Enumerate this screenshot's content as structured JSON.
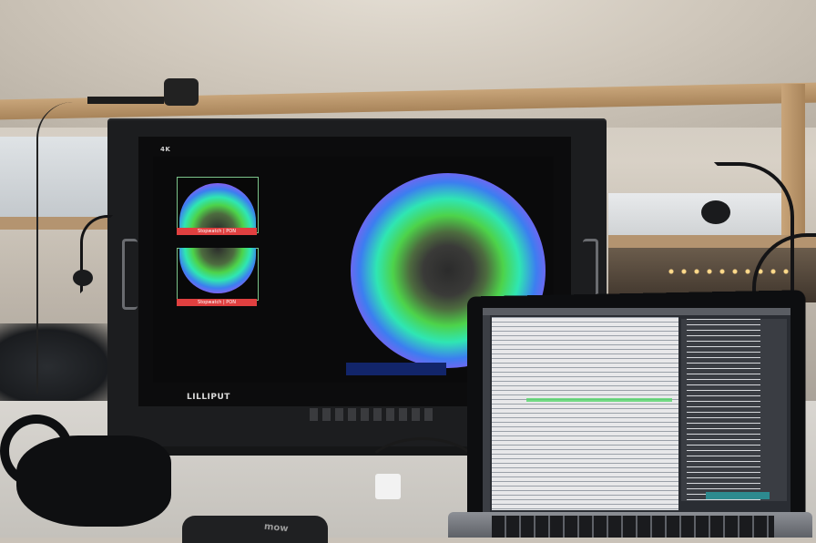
{
  "scene": {
    "monitor": {
      "brand_top_left": "4K",
      "brand_logo": "LILLIPUT",
      "scope_labels": [
        "Stopwatch | PON",
        "Stopwatch | PON"
      ]
    },
    "laptop": {},
    "headphones": {},
    "box": {
      "label": "mow"
    }
  }
}
